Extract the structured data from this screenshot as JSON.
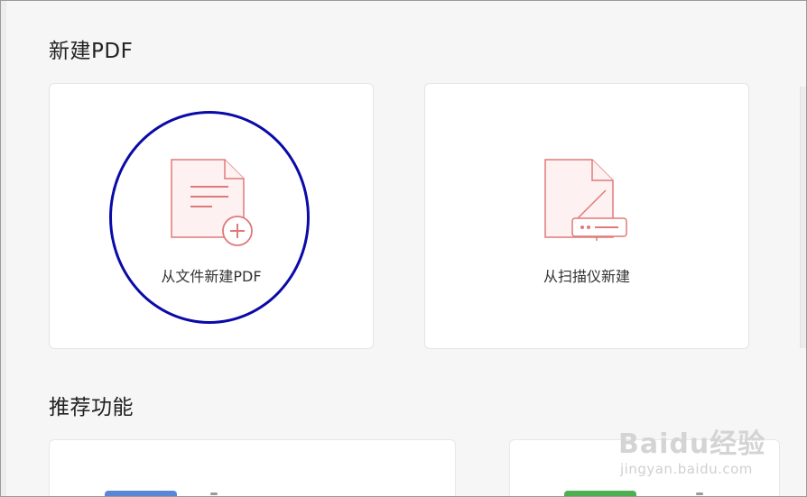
{
  "sections": {
    "new_pdf_title": "新建PDF",
    "recommended_title": "推荐功能"
  },
  "cards": {
    "from_file": {
      "label": "从文件新建PDF",
      "icon": "file-add-icon"
    },
    "from_scanner": {
      "label": "从扫描仪新建",
      "icon": "scanner-icon"
    }
  },
  "watermark": {
    "logo": "Baidu经验",
    "url": "jingyan.baidu.com"
  },
  "colors": {
    "icon_stroke": "#e07a7a",
    "icon_fill": "#fdf1f1",
    "highlight": "#0a0aa8",
    "blue_tile": "#5a86d6",
    "green_tile": "#4cb050"
  }
}
